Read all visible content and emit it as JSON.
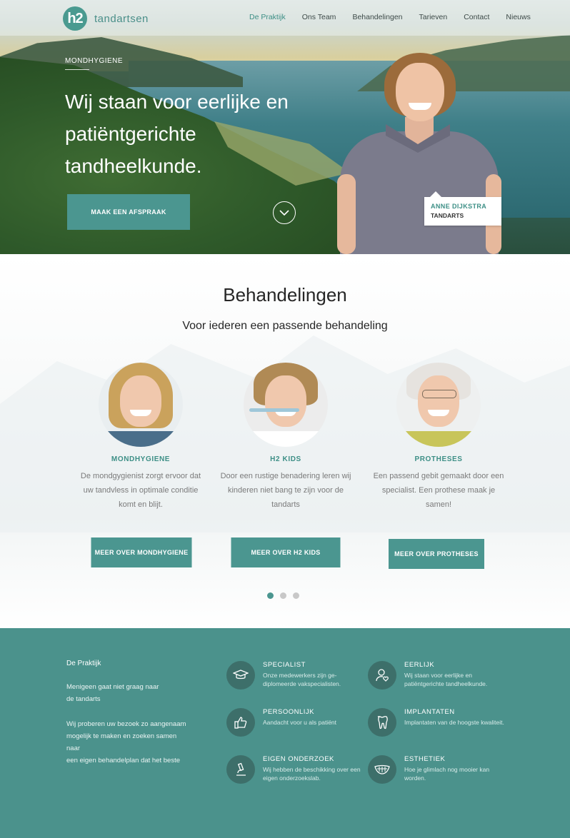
{
  "brand": {
    "logo_mark": "h2",
    "name": "tandartsen",
    "accent": "#4b9690"
  },
  "nav": {
    "items": [
      {
        "label": "De Praktijk",
        "active": true
      },
      {
        "label": "Ons Team"
      },
      {
        "label": "Behandelingen"
      },
      {
        "label": "Tarieven"
      },
      {
        "label": "Contact"
      },
      {
        "label": "Nieuws"
      }
    ]
  },
  "hero": {
    "eyebrow": "MONDHYGIENE",
    "title": "Wij staan voor eerlijke en patiëntgerichte tandheelkunde.",
    "cta_label": "MAAK EEN AFSPRAAK",
    "scroll_icon": "chevron-down-icon",
    "person": {
      "name": "ANNE DIJKSTRA",
      "role": "TANDARTS"
    }
  },
  "treatments": {
    "title": "Behandelingen",
    "subtitle": "Voor iederen een passende behandeling",
    "cards": [
      {
        "title": "MONDHYGIENE",
        "text": "De mondgygienist zorgt ervoor dat uw tandvless in optimale conditie komt en blijt.",
        "button": "MEER OVER MONDHYGIENE"
      },
      {
        "title": "H2 KIDS",
        "text": "Door een rustige benadering leren wij kinderen niet bang te zijn voor de tandarts",
        "button": "MEER OVER H2 KIDS"
      },
      {
        "title": "PROTHESES",
        "text": "Een passend gebit gemaakt door een specialist. Een prothese maak je samen!",
        "button": "MEER OVER PROTHESES"
      }
    ],
    "carousel": {
      "pages": 3,
      "active": 1
    }
  },
  "footer": {
    "about_title": "De Praktijk",
    "about_p1": "Menigeen gaat niet graag naar\nde tandarts",
    "about_p2": "Wij proberen uw bezoek zo aangenaam\nmogelijk te maken en zoeken samen\nnaar\neen eigen behandelplan dat het beste",
    "features": [
      {
        "icon": "graduation-cap-icon",
        "title": "SPECIALIST",
        "desc": "Onze medewerkers zijn ge-diplomeerde vakspecialisten."
      },
      {
        "icon": "user-heart-icon",
        "title": "EERLIJK",
        "desc": "Wij staan voor eerlijke en patiëntgerichte tandheelkunde."
      },
      {
        "icon": "thumbs-up-icon",
        "title": "PERSOONLIJK",
        "desc": "Aandacht voor u als patiënt"
      },
      {
        "icon": "tooth-icon",
        "title": "IMPLANTATEN",
        "desc": "Implantaten van de hoogste kwaliteit."
      },
      {
        "icon": "microscope-icon",
        "title": "EIGEN ONDERZOEK",
        "desc": "Wij hebben de beschikking over een eigen onderzoekslab."
      },
      {
        "icon": "smile-teeth-icon",
        "title": "ESTHETIEK",
        "desc": "Hoe je glimlach nog mooier kan worden."
      }
    ]
  }
}
